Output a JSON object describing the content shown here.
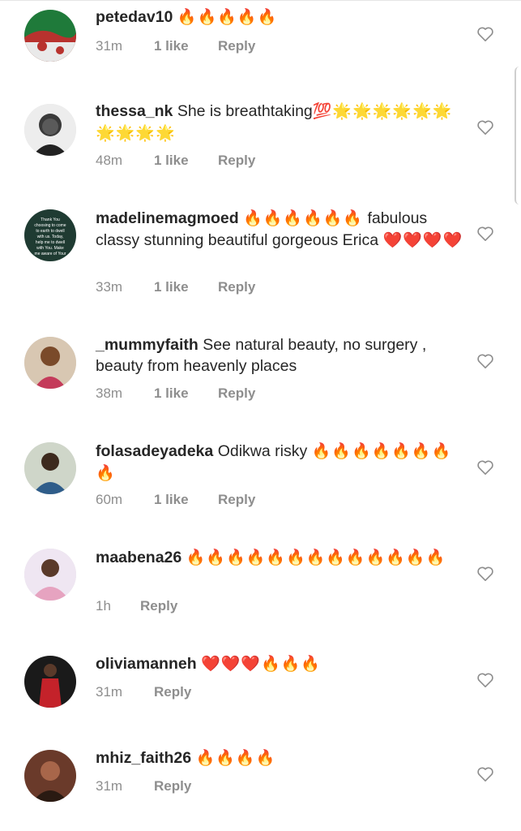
{
  "comments": [
    {
      "username": "petedav10",
      "text": "",
      "emoji": "🔥🔥🔥🔥🔥",
      "time": "31m",
      "likes": "1 like",
      "reply": "Reply"
    },
    {
      "username": "thessa_nk",
      "text": "She is breathtaking",
      "emoji": "💯🌟🌟🌟🌟🌟🌟🌟🌟🌟🌟",
      "time": "48m",
      "likes": "1 like",
      "reply": "Reply"
    },
    {
      "username": "madelinemagmoed",
      "text": "",
      "emoji": "🔥🔥🔥🔥🔥🔥",
      "text2": "fabulous classy stunning beautiful gorgeous Erica",
      "emoji2": "❤️❤️❤️❤️",
      "time": "33m",
      "likes": "1 like",
      "reply": "Reply"
    },
    {
      "username": "_mummyfaith",
      "text": "See natural beauty, no surgery , beauty from heavenly places",
      "emoji": "",
      "time": "38m",
      "likes": "1 like",
      "reply": "Reply"
    },
    {
      "username": "folasadeyadeka",
      "text": "Odikwa risky",
      "emoji": "🔥🔥🔥🔥🔥🔥🔥🔥",
      "time": "60m",
      "likes": "1 like",
      "reply": "Reply"
    },
    {
      "username": "maabena26",
      "text": "",
      "emoji": "🔥🔥🔥🔥🔥🔥🔥🔥🔥🔥🔥🔥🔥",
      "time": "1h",
      "likes": "",
      "reply": "Reply"
    },
    {
      "username": "oliviamanneh",
      "text": "",
      "emoji": "❤️❤️❤️🔥🔥🔥",
      "time": "31m",
      "likes": "",
      "reply": "Reply"
    },
    {
      "username": "mhiz_faith26",
      "text": "",
      "emoji": "🔥🔥🔥🔥",
      "time": "31m",
      "likes": "",
      "reply": "Reply"
    }
  ],
  "avatar_text": "Thank You for choosing to come to earth to dwell with us. Today, help me to dwell with You. Make me aware of Your presence around me, and show me glimpses of"
}
